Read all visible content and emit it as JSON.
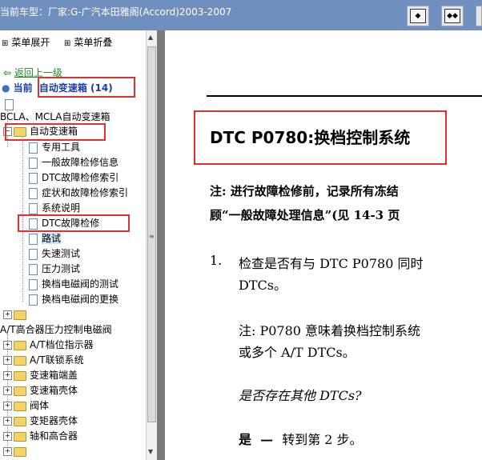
{
  "titlebar": {
    "title": "当前车型：厂家:G-广汽本田雅阁(Accord)2003-2007",
    "buttons": [
      "single-page",
      "two-page",
      "options"
    ]
  },
  "left": {
    "expand_all": "菜单展开",
    "collapse_all": "菜单折叠",
    "back": "返回上一级",
    "current_prefix": "当前",
    "current_value": "自动变速箱 (14)",
    "items": [
      "BCLA、MCLA自动变速箱",
      "自动变速箱",
      "专用工具",
      "一般故障检修信息",
      "DTC故障检修索引",
      "症状和故障检修索引",
      "系统说明",
      "DTC故障检修",
      "路试",
      "失速测试",
      "压力测试",
      "换档电磁阀的测试",
      "换档电磁阀的更换",
      "A/T高合器压力控制电磁阀",
      "A/T档位指示器",
      "A/T联锁系统",
      "变速箱端盖",
      "变速箱壳体",
      "阀体",
      "变矩器壳体",
      "轴和高合器"
    ]
  },
  "doc": {
    "heading": "DTC P0780:换档控制系统",
    "note1_a": "注: 进行故障检修前，记录所有冻结",
    "note1_b": "顾“一般故障处理信息”(见 14-3 页",
    "step_num": "1.",
    "step_a": "检查是否有与 DTC P0780 同时",
    "step_b": "DTCs。",
    "note2_a": "注: P0780 意味着换档控制系统",
    "note2_b": "或多个 A/T DTCs。",
    "question": "是否存在其他 DTCs?",
    "answer_yes": "是",
    "answer_dash": "—",
    "answer_text": "转到第 2 步。"
  }
}
